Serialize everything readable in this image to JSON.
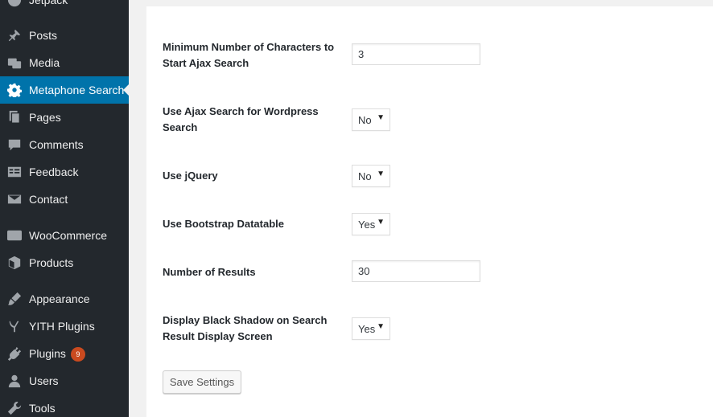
{
  "sidebar": {
    "items": [
      {
        "label": "Jetpack",
        "icon": "jetpack-icon"
      },
      {
        "label": "Posts",
        "icon": "pin-icon"
      },
      {
        "label": "Media",
        "icon": "media-icon"
      },
      {
        "label": "Metaphone Search",
        "icon": "gear-icon",
        "active": true
      },
      {
        "label": "Pages",
        "icon": "pages-icon"
      },
      {
        "label": "Comments",
        "icon": "comment-icon"
      },
      {
        "label": "Feedback",
        "icon": "feedback-icon"
      },
      {
        "label": "Contact",
        "icon": "mail-icon"
      },
      {
        "label": "WooCommerce",
        "icon": "woo-icon"
      },
      {
        "label": "Products",
        "icon": "box-icon"
      },
      {
        "label": "Appearance",
        "icon": "brush-icon"
      },
      {
        "label": "YITH Plugins",
        "icon": "yith-icon"
      },
      {
        "label": "Plugins",
        "icon": "plug-icon",
        "badge": "9"
      },
      {
        "label": "Users",
        "icon": "user-icon"
      },
      {
        "label": "Tools",
        "icon": "wrench-icon"
      }
    ]
  },
  "settings": {
    "min_chars": {
      "label": "Minimum Number of Characters to Start Ajax Search",
      "value": "3"
    },
    "ajax_wp_search": {
      "label": "Use Ajax Search for Wordpress Search",
      "value": "No"
    },
    "use_jquery": {
      "label": "Use jQuery",
      "value": "No"
    },
    "bootstrap_datatable": {
      "label": "Use Bootstrap Datatable",
      "value": "Yes"
    },
    "num_results": {
      "label": "Number of Results",
      "value": "30"
    },
    "black_shadow": {
      "label": "Display Black Shadow on Search Result Display Screen",
      "value": "Yes"
    },
    "save_label": "Save Settings"
  },
  "colors": {
    "sidebar_bg": "#23282d",
    "active_bg": "#0073aa",
    "badge_bg": "#ca4a1f"
  }
}
